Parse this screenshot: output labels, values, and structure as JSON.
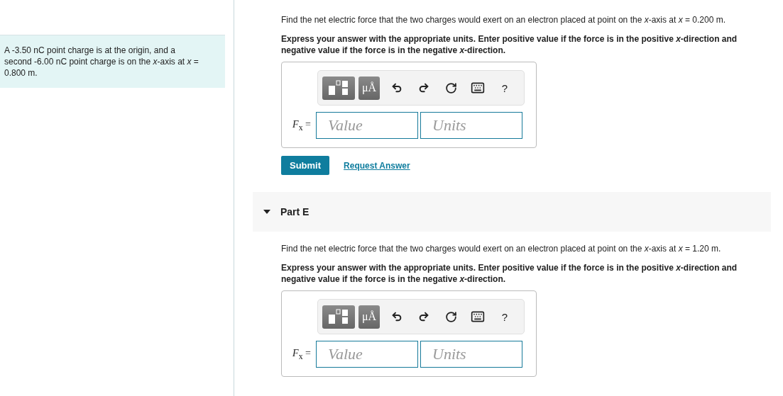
{
  "intro": "A -3.50 nC point charge is at the origin, and a second -6.00 nC point charge is on the *x*-axis at *x* = 0.800 m.",
  "parts": [
    {
      "question": "Find the net electric force that the two charges would exert on an electron placed at point on the *x*-axis at *x* = 0.200 m.",
      "instruction": "Express your answer with the appropriate units. Enter positive value if the force is in the positive *x*-direction and negative value if the force is in the negative *x*-direction.",
      "toolbar": {
        "units_button": "μÅ",
        "help": "?"
      },
      "label": "*F*$_{x}$ =",
      "value_placeholder": "Value",
      "units_placeholder": "Units",
      "actions": {
        "submit": "Submit",
        "request": "Request Answer"
      }
    },
    {
      "header": {
        "title": "Part E",
        "expanded": true
      },
      "question": "Find the net electric force that the two charges would exert on an electron placed at point on the *x*-axis at *x* = 1.20 m.",
      "instruction": "Express your answer with the appropriate units. Enter positive value if the force is in the positive *x*-direction and negative value if the force is in the negative *x*-direction.",
      "toolbar": {
        "units_button": "μÅ",
        "help": "?"
      },
      "label": "*F*$_{x}$ =",
      "value_placeholder": "Value",
      "units_placeholder": "Units"
    }
  ]
}
